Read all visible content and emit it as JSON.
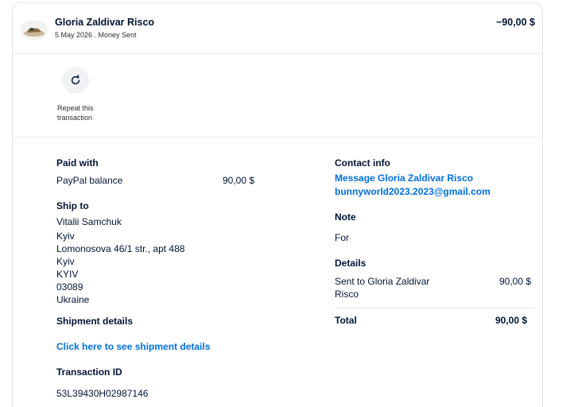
{
  "header": {
    "name": "Gloria Zaldivar Risco",
    "subtitle": "5 May 2026 . Money Sent",
    "amount": "−90,00 $"
  },
  "repeat": {
    "icon": "refresh-icon",
    "label": "Repeat this transaction"
  },
  "paid_with": {
    "label": "Paid with",
    "method": "PayPal balance",
    "amount": "90,00 $"
  },
  "ship_to": {
    "label": "Ship to",
    "lines": [
      "Vitalii Samchuk",
      "Kyiv",
      "Lomonosova 46/1 str., apt 488",
      "Kyiv",
      "KYIV",
      "03089",
      "Ukraine"
    ]
  },
  "shipment": {
    "label": "Shipment details",
    "link": "Click here to see shipment details"
  },
  "transaction": {
    "label": "Transaction ID",
    "id": "53L39430H02987146"
  },
  "contact": {
    "label": "Contact info",
    "message_link": "Message Gloria Zaldivar Risco",
    "email_link": "bunnyworld2023.2023@gmail.com"
  },
  "note": {
    "label": "Note",
    "text": "For"
  },
  "details": {
    "label": "Details",
    "row_label": "Sent to Gloria Zaldivar Risco",
    "row_amount": "90,00 $",
    "total_label": "Total",
    "total_amount": "90,00 $"
  },
  "colors": {
    "link": "#0070e0",
    "text": "#001435"
  }
}
